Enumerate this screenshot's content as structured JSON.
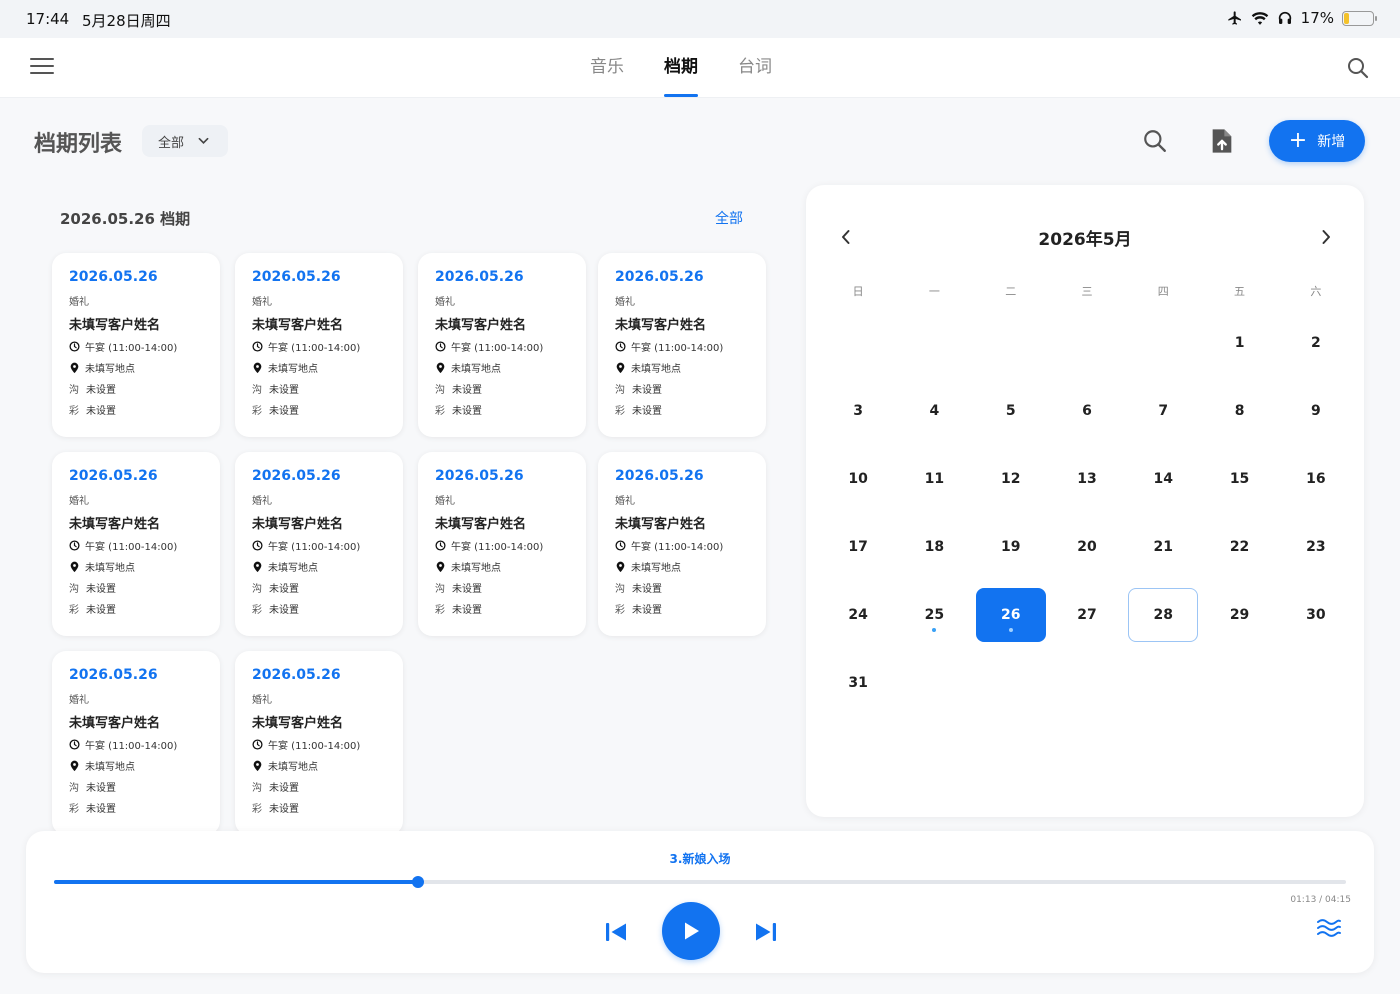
{
  "status_bar": {
    "time": "17:44",
    "date": "5月28日周四",
    "battery": "17%",
    "battery_level": 0.17
  },
  "header": {
    "tabs": [
      {
        "label": "音乐",
        "active": false
      },
      {
        "label": "档期",
        "active": true
      },
      {
        "label": "台词",
        "active": false
      }
    ]
  },
  "toolbar": {
    "title": "档期列表",
    "filter_value": "全部",
    "add_label": "新增"
  },
  "list": {
    "section_title": "2026.05.26 档期",
    "all_link": "全部",
    "cards": [
      {
        "date": "2026.05.26",
        "type": "婚礼",
        "customer": "未填写客户姓名",
        "time": "午宴 (11:00-14:00)",
        "location": "未填写地点",
        "comm_key": "沟",
        "comm_value": "未设置",
        "rehearsal_key": "彩",
        "rehearsal_value": "未设置"
      },
      {
        "date": "2026.05.26",
        "type": "婚礼",
        "customer": "未填写客户姓名",
        "time": "午宴 (11:00-14:00)",
        "location": "未填写地点",
        "comm_key": "沟",
        "comm_value": "未设置",
        "rehearsal_key": "彩",
        "rehearsal_value": "未设置"
      },
      {
        "date": "2026.05.26",
        "type": "婚礼",
        "customer": "未填写客户姓名",
        "time": "午宴 (11:00-14:00)",
        "location": "未填写地点",
        "comm_key": "沟",
        "comm_value": "未设置",
        "rehearsal_key": "彩",
        "rehearsal_value": "未设置"
      },
      {
        "date": "2026.05.26",
        "type": "婚礼",
        "customer": "未填写客户姓名",
        "time": "午宴 (11:00-14:00)",
        "location": "未填写地点",
        "comm_key": "沟",
        "comm_value": "未设置",
        "rehearsal_key": "彩",
        "rehearsal_value": "未设置"
      },
      {
        "date": "2026.05.26",
        "type": "婚礼",
        "customer": "未填写客户姓名",
        "time": "午宴 (11:00-14:00)",
        "location": "未填写地点",
        "comm_key": "沟",
        "comm_value": "未设置",
        "rehearsal_key": "彩",
        "rehearsal_value": "未设置"
      },
      {
        "date": "2026.05.26",
        "type": "婚礼",
        "customer": "未填写客户姓名",
        "time": "午宴 (11:00-14:00)",
        "location": "未填写地点",
        "comm_key": "沟",
        "comm_value": "未设置",
        "rehearsal_key": "彩",
        "rehearsal_value": "未设置"
      },
      {
        "date": "2026.05.26",
        "type": "婚礼",
        "customer": "未填写客户姓名",
        "time": "午宴 (11:00-14:00)",
        "location": "未填写地点",
        "comm_key": "沟",
        "comm_value": "未设置",
        "rehearsal_key": "彩",
        "rehearsal_value": "未设置"
      },
      {
        "date": "2026.05.26",
        "type": "婚礼",
        "customer": "未填写客户姓名",
        "time": "午宴 (11:00-14:00)",
        "location": "未填写地点",
        "comm_key": "沟",
        "comm_value": "未设置",
        "rehearsal_key": "彩",
        "rehearsal_value": "未设置"
      },
      {
        "date": "2026.05.26",
        "type": "婚礼",
        "customer": "未填写客户姓名",
        "time": "午宴 (11:00-14:00)",
        "location": "未填写地点",
        "comm_key": "沟",
        "comm_value": "未设置",
        "rehearsal_key": "彩",
        "rehearsal_value": "未设置"
      },
      {
        "date": "2026.05.26",
        "type": "婚礼",
        "customer": "未填写客户姓名",
        "time": "午宴 (11:00-14:00)",
        "location": "未填写地点",
        "comm_key": "沟",
        "comm_value": "未设置",
        "rehearsal_key": "彩",
        "rehearsal_value": "未设置"
      }
    ]
  },
  "calendar": {
    "title": "2026年5月",
    "weekdays": [
      "日",
      "一",
      "二",
      "三",
      "四",
      "五",
      "六"
    ],
    "leading_blanks": 5,
    "days_in_month": 31,
    "selected_day": 26,
    "today_day": 28,
    "event_days": [
      25,
      26
    ]
  },
  "player": {
    "track": "3.新娘入场",
    "elapsed": "01:13",
    "duration": "04:15",
    "time_display": "01:13 / 04:15",
    "progress": 0.282
  },
  "colors": {
    "accent": "#1273f0",
    "today_border": "#9cc5f5",
    "event_dot": "#3aa1f5"
  }
}
